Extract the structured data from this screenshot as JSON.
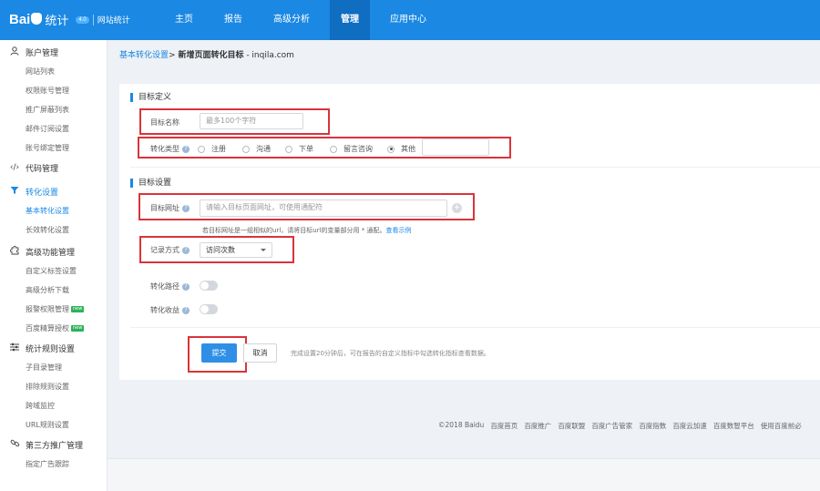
{
  "header": {
    "logo_text": "Bai",
    "logo_text2": "统计",
    "logo_version": "4.0",
    "site_name": "网站统计",
    "nav": [
      "主页",
      "报告",
      "高级分析",
      "管理",
      "应用中心"
    ],
    "active_nav": "管理"
  },
  "sidebar": {
    "groups": [
      {
        "label": "账户管理",
        "icon": "user-icon",
        "items": [
          "网站列表",
          "权限账号管理",
          "推广屏蔽列表",
          "邮件订阅设置",
          "账号绑定管理"
        ]
      },
      {
        "label": "代码管理",
        "icon": "code-icon",
        "items": []
      },
      {
        "label": "转化设置",
        "icon": "filter-icon",
        "items": [
          "基本转化设置",
          "长效转化设置"
        ]
      },
      {
        "label": "高级功能管理",
        "icon": "puzzle-icon",
        "items": [
          "自定义标签设置",
          "高级分析下载",
          "报警权限管理",
          "百度精算授权"
        ]
      },
      {
        "label": "统计规则设置",
        "icon": "sliders-icon",
        "items": [
          "子目录管理",
          "排除规则设置",
          "跨域监控",
          "URL规则设置"
        ]
      },
      {
        "label": "第三方推广管理",
        "icon": "link-icon",
        "items": [
          "指定广告跟踪"
        ]
      }
    ],
    "new_badge": "new",
    "active_group": "转化设置",
    "active_item": "基本转化设置"
  },
  "breadcrumb": {
    "parent": "基本转化设置",
    "sep": ">",
    "current": "新增页面转化目标",
    "site": "- inqila.com"
  },
  "form": {
    "section1_title": "目标定义",
    "goal_name_label": "目标名称",
    "goal_name_placeholder": "最多100个字符",
    "conv_type_label": "转化类型",
    "conv_types": [
      "注册",
      "沟通",
      "下单",
      "留言咨询",
      "其他"
    ],
    "conv_type_selected": "其他",
    "section2_title": "目标设置",
    "goal_url_label": "目标网址",
    "goal_url_placeholder": "请输入目标页面网址，可使用通配符",
    "goal_url_hint": "若目标网址是一组相似的url，请将目标url的变量部分用 * 通配。",
    "goal_url_hint_link": "查看示例",
    "record_label": "记录方式",
    "record_value": "访问次数",
    "path_label": "转化路径",
    "revenue_label": "转化收益",
    "submit_label": "提交",
    "cancel_label": "取消",
    "submit_note": "完成设置20分钟后，可在报告的自定义指标中勾选转化指标查看数据。"
  },
  "footer": {
    "links": [
      "©2018 Baidu",
      "百度首页",
      "百度推广",
      "百度联盟",
      "百度广告管家",
      "百度指数",
      "百度云加速",
      "百度数智平台",
      "使用百度前必"
    ]
  },
  "colors": {
    "brand": "#1b88e3",
    "highlight": "#d9343a",
    "new_badge": "#2cb35b"
  }
}
